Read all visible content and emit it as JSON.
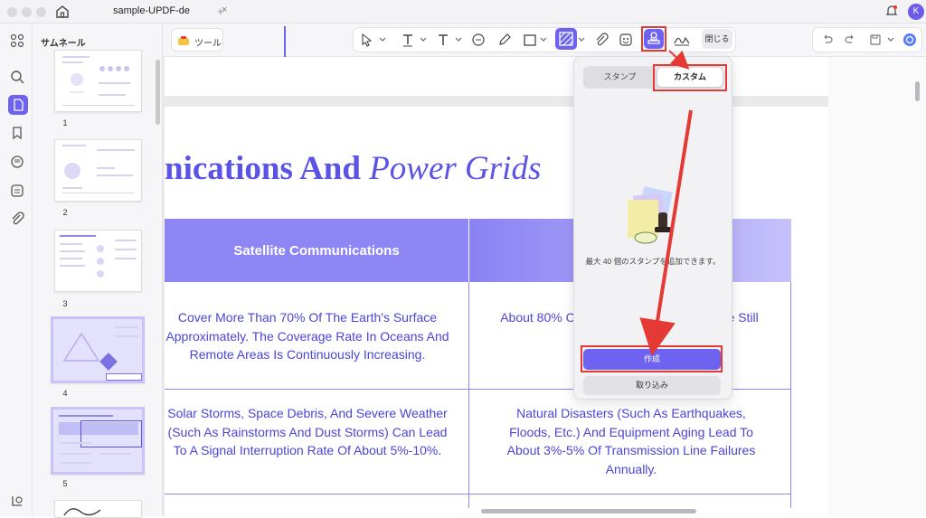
{
  "window": {
    "tab_title": "sample-UPDF-de",
    "tab_close": "×",
    "tab_add": "+",
    "avatar_letter": "K"
  },
  "sidebar": {
    "title": "サムネール",
    "pages": [
      "1",
      "2",
      "3",
      "4",
      "5"
    ]
  },
  "toolbar": {
    "tool_label": "ツール",
    "close_label": "閉じる"
  },
  "document": {
    "title_bold": "nications And",
    "title_italic": "Power Grids",
    "table_header_left": "Satellite Communications",
    "rows": [
      {
        "left": "Cover More Than 70% Of The Earth's Surface Approximately. The Coverage Rate In Oceans And Remote Areas Is Continuously Increasing.",
        "right": "About 80% Of ... overed By Power Gri... e Still"
      },
      {
        "left": "Solar Storms, Space Debris, And Severe Weather (Such As Rainstorms And Dust Storms) Can Lead To A Signal Interruption Rate Of About 5%-10%.",
        "right": "Natural Disasters (Such As Earthquakes, Floods, Etc.) And Equipment Aging Lead To About 3%-5% Of Transmission Line Failures Annually."
      }
    ]
  },
  "stamp_popup": {
    "tab_stamp": "スタンプ",
    "tab_custom": "カスタム",
    "description": "最大 40 個のスタンプを追加できます。",
    "create_button": "作成",
    "import_button": "取り込み"
  },
  "colors": {
    "accent": "#6e63f0",
    "annotation": "#e53935",
    "title_text": "#5b53e6"
  }
}
